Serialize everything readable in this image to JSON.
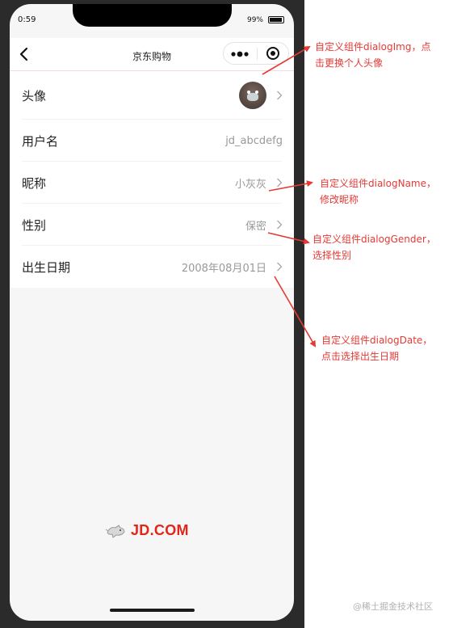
{
  "status_bar": {
    "time": "0:59",
    "battery": "99%"
  },
  "navbar": {
    "title": "京东购物"
  },
  "rows": [
    {
      "label": "头像",
      "value": "",
      "type": "avatar"
    },
    {
      "label": "用户名",
      "value": "jd_abcdefg"
    },
    {
      "label": "昵称",
      "value": "小灰灰"
    },
    {
      "label": "性别",
      "value": "保密"
    },
    {
      "label": "出生日期",
      "value": "2008年08月01日"
    }
  ],
  "brand": {
    "logo_text": "JD.COM",
    "color": "#e1251b"
  },
  "annotations": [
    {
      "line1": "自定义组件dialogImg，点",
      "line2": "击更换个人头像"
    },
    {
      "line1": "自定义组件dialogName，",
      "line2": "修改昵称"
    },
    {
      "line1": "自定义组件dialogGender，",
      "line2": "选择性别"
    },
    {
      "line1": "自定义组件dialogDate，",
      "line2": "点击选择出生日期"
    }
  ],
  "annotation_color": "#e53935",
  "watermark": "@稀土掘金技术社区"
}
